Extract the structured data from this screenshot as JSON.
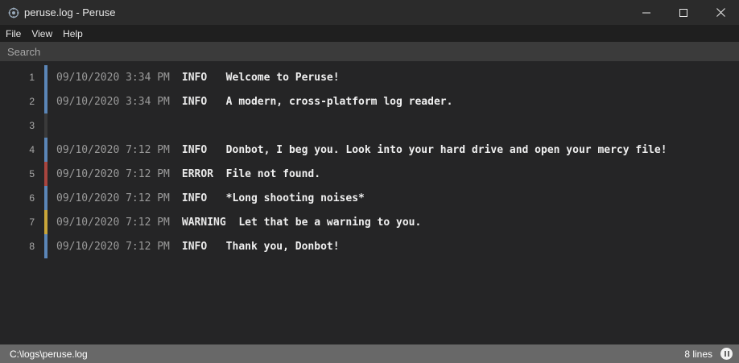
{
  "window": {
    "title": "peruse.log - Peruse"
  },
  "menu": {
    "items": [
      "File",
      "View",
      "Help"
    ]
  },
  "search": {
    "placeholder": "Search",
    "value": ""
  },
  "colors": {
    "info": "#5b86b8",
    "error": "#a8453f",
    "warning": "#c9a63a",
    "empty": "#3a3a3a"
  },
  "log": {
    "rows": [
      {
        "line": "1",
        "timestamp": "09/10/2020 3:34 PM",
        "level": "INFO",
        "message": "Welcome to Peruse!",
        "color_key": "info"
      },
      {
        "line": "2",
        "timestamp": "09/10/2020 3:34 PM",
        "level": "INFO",
        "message": "A modern, cross-platform log reader.",
        "color_key": "info"
      },
      {
        "line": "3",
        "timestamp": "",
        "level": "",
        "message": "",
        "color_key": "empty"
      },
      {
        "line": "4",
        "timestamp": "09/10/2020 7:12 PM",
        "level": "INFO",
        "message": "Donbot, I beg you. Look into your hard drive and open your mercy file!",
        "color_key": "info"
      },
      {
        "line": "5",
        "timestamp": "09/10/2020 7:12 PM",
        "level": "ERROR",
        "message": "File not found.",
        "color_key": "error"
      },
      {
        "line": "6",
        "timestamp": "09/10/2020 7:12 PM",
        "level": "INFO",
        "message": "*Long shooting noises*",
        "color_key": "info"
      },
      {
        "line": "7",
        "timestamp": "09/10/2020 7:12 PM",
        "level": "WARNING",
        "message": "Let that be a warning to you.",
        "color_key": "warning"
      },
      {
        "line": "8",
        "timestamp": "09/10/2020 7:12 PM",
        "level": "INFO",
        "message": "Thank you, Donbot!",
        "color_key": "info"
      }
    ]
  },
  "status": {
    "path": "C:\\logs\\peruse.log",
    "line_count": "8 lines"
  }
}
